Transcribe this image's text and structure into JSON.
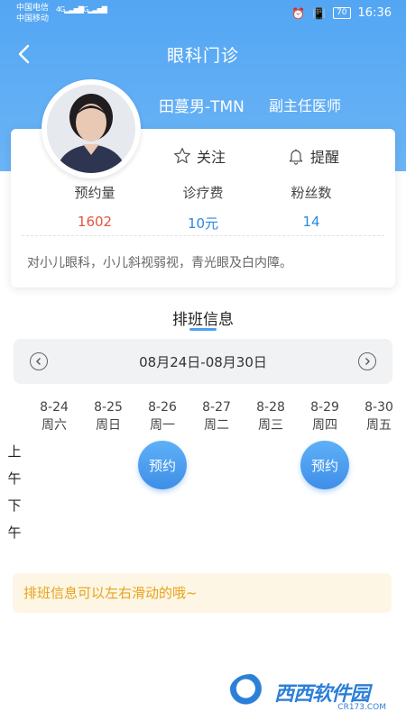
{
  "status_bar": {
    "carrier1": "中国电信",
    "carrier2": "中国移动",
    "net1": "4G",
    "net2": "2G",
    "battery": "70",
    "time": "16:36"
  },
  "nav": {
    "title": "眼科门诊",
    "back_icon": "chevron-left-icon"
  },
  "doctor": {
    "name": "田蔓男-TMN",
    "title": "副主任医师"
  },
  "actions": {
    "follow": "关注",
    "remind": "提醒"
  },
  "stats": [
    {
      "label": "预约量",
      "value": "1602",
      "color": "#e4553d"
    },
    {
      "label": "诊疗费",
      "value": "10元",
      "color": "#2b88e0"
    },
    {
      "label": "粉丝数",
      "value": "14",
      "color": "#2b88e0"
    }
  ],
  "intro": "对小儿眼科，小儿斜视弱视，青光眼及白内障。",
  "schedule": {
    "title": "排班信息",
    "range": "08月24日-08月30日",
    "days": [
      {
        "date": "8-24",
        "weekday": "周六"
      },
      {
        "date": "8-25",
        "weekday": "周日"
      },
      {
        "date": "8-26",
        "weekday": "周一"
      },
      {
        "date": "8-27",
        "weekday": "周二"
      },
      {
        "date": "8-28",
        "weekday": "周三"
      },
      {
        "date": "8-29",
        "weekday": "周四"
      },
      {
        "date": "8-30",
        "weekday": "周五"
      }
    ],
    "am": [
      "上",
      "午"
    ],
    "pm": [
      "下",
      "午"
    ],
    "book_label": "预约",
    "bookings": [
      {
        "day": "8-26",
        "period": "上午"
      },
      {
        "day": "8-29",
        "period": "上午"
      }
    ]
  },
  "tip": "排班信息可以左右滑动的哦~",
  "watermark": {
    "brand": "西西软件园",
    "site": "CR173.COM"
  },
  "colors": {
    "primary": "#53a6f3",
    "tip_bg": "#fdf6e4",
    "tip_text": "#e8a21b"
  }
}
